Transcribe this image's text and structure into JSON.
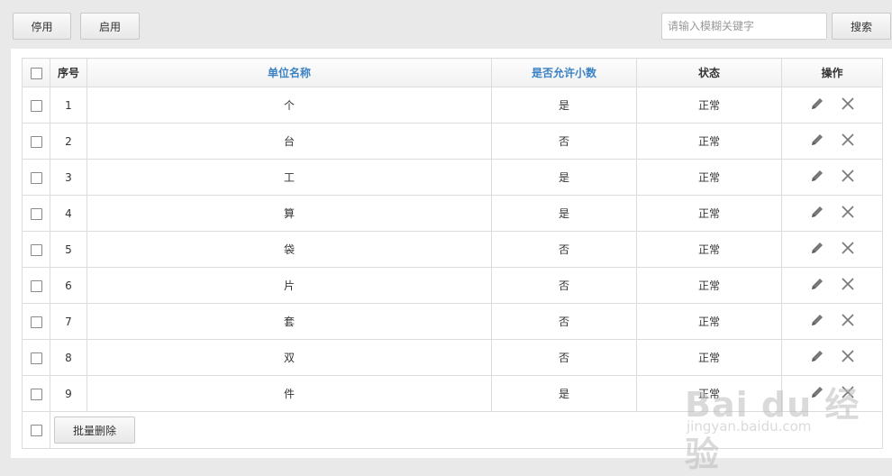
{
  "toolbar": {
    "stop_label": "停用",
    "enable_label": "启用",
    "search_placeholder": "请输入模糊关键字",
    "search_value": "",
    "search_label": "搜索"
  },
  "table": {
    "headers": {
      "index": "序号",
      "unit_name": "单位名称",
      "allow_decimal": "是否允许小数",
      "status": "状态",
      "actions": "操作"
    },
    "rows": [
      {
        "index": "1",
        "unit_name": "个",
        "allow_decimal": "是",
        "status": "正常"
      },
      {
        "index": "2",
        "unit_name": "台",
        "allow_decimal": "否",
        "status": "正常"
      },
      {
        "index": "3",
        "unit_name": "工",
        "allow_decimal": "是",
        "status": "正常"
      },
      {
        "index": "4",
        "unit_name": "算",
        "allow_decimal": "是",
        "status": "正常"
      },
      {
        "index": "5",
        "unit_name": "袋",
        "allow_decimal": "否",
        "status": "正常"
      },
      {
        "index": "6",
        "unit_name": "片",
        "allow_decimal": "否",
        "status": "正常"
      },
      {
        "index": "7",
        "unit_name": "套",
        "allow_decimal": "否",
        "status": "正常"
      },
      {
        "index": "8",
        "unit_name": "双",
        "allow_decimal": "否",
        "status": "正常"
      },
      {
        "index": "9",
        "unit_name": "件",
        "allow_decimal": "是",
        "status": "正常"
      }
    ],
    "batch_delete_label": "批量删除"
  },
  "row_actions": {
    "edit_icon": "pencil-icon",
    "delete_icon": "close-icon"
  },
  "colors": {
    "sortable_header": "#3b82c4",
    "background": "#e9e9e9"
  },
  "watermark": {
    "main": "Bai du 经验",
    "sub": "jingyan.baidu.com"
  }
}
